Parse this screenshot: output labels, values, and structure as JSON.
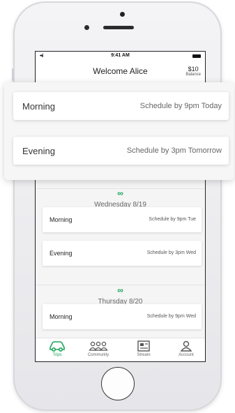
{
  "status": {
    "signal": "••ıl",
    "time": "9:41 AM"
  },
  "header": {
    "title": "Welcome Alice",
    "balance_amount": "$10",
    "balance_label": "Balance"
  },
  "popup": {
    "options": [
      {
        "label": "Morning",
        "schedule": "Schedule by 9pm Today"
      },
      {
        "label": "Evening",
        "schedule": "Schedule by 3pm Tomorrow"
      }
    ]
  },
  "days": [
    {
      "icon": "loop-icon",
      "date": "Wednesday 8/19",
      "slots": [
        {
          "label": "Morning",
          "schedule": "Schedule by 9pm Tue"
        },
        {
          "label": "Evening",
          "schedule": "Schedule by 3pm Wed"
        }
      ]
    },
    {
      "icon": "loop-icon",
      "date": "Thursday 8/20",
      "slots": [
        {
          "label": "Morning",
          "schedule": "Schedule by 9pm Wed"
        }
      ]
    }
  ],
  "tabs": [
    {
      "label": "Trips",
      "icon": "car-icon",
      "active": true
    },
    {
      "label": "Community",
      "icon": "community-icon",
      "active": false
    },
    {
      "label": "Stream",
      "icon": "stream-icon",
      "active": false
    },
    {
      "label": "Account",
      "icon": "account-icon",
      "active": false
    }
  ],
  "colors": {
    "accent": "#19a55a",
    "text": "#333333",
    "background": "#f5f5f5"
  }
}
